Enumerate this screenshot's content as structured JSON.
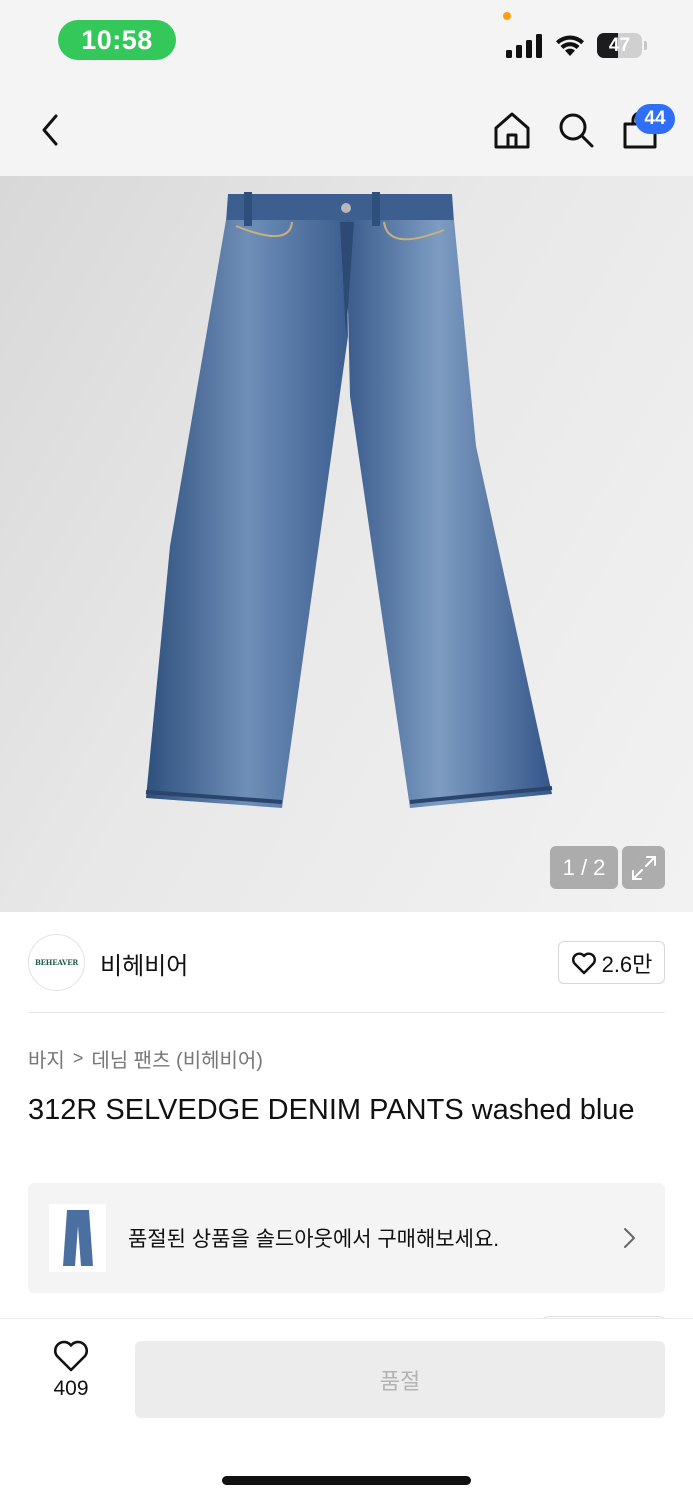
{
  "status_bar": {
    "time": "10:58",
    "battery_level": "47",
    "battery_fraction": 0.47
  },
  "nav": {
    "cart_badge": "44",
    "icons": [
      "back-icon",
      "home-icon",
      "search-icon",
      "cart-icon"
    ]
  },
  "gallery": {
    "counter": "1 / 2",
    "icons": [
      "expand-icon"
    ]
  },
  "brand": {
    "logo_text": "BEHEAVER",
    "name": "비헤비어",
    "like_count": "2.6만"
  },
  "breadcrumb": {
    "items": [
      "바지",
      "데님 팬츠 (비헤비어)"
    ],
    "separator": ">"
  },
  "product": {
    "title": "312R SELVEDGE DENIM PANTS washed blue"
  },
  "soldout_banner": {
    "text": "품절된 상품을 솔드아웃에서 구매해보세요."
  },
  "bottom_bar": {
    "wish_count": "409",
    "buy_label": "품절"
  },
  "colors": {
    "status_green": "#34c759",
    "badge_blue": "#2f6ef6",
    "denim": "#4a6fa0",
    "disabled_button_bg": "#ececec",
    "disabled_button_text": "#b3b3b3"
  }
}
